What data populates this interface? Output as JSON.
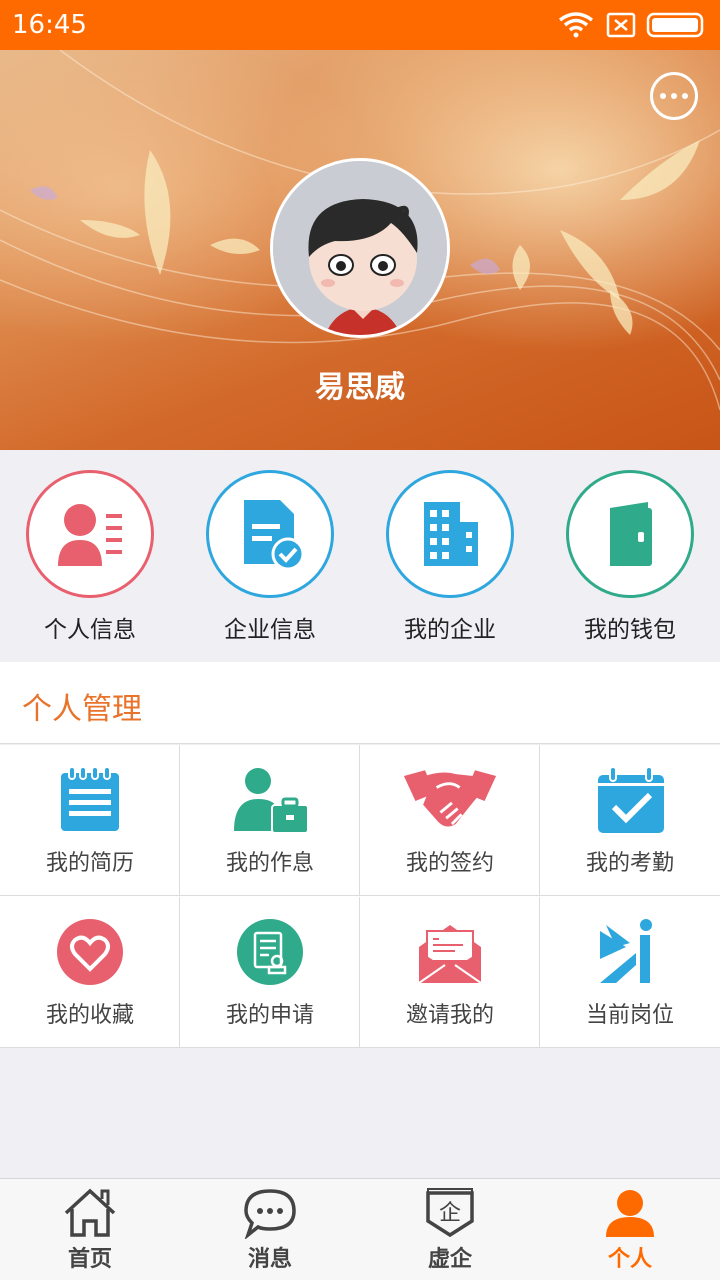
{
  "status_bar": {
    "time": "16:45"
  },
  "header": {
    "user_name": "易思威",
    "more_icon": "more-dots-icon"
  },
  "quick_actions": [
    {
      "label": "个人信息",
      "icon": "profile-card-icon",
      "color": "#e8606e"
    },
    {
      "label": "企业信息",
      "icon": "document-check-icon",
      "color": "#2ea7df"
    },
    {
      "label": "我的企业",
      "icon": "building-icon",
      "color": "#2ea7df"
    },
    {
      "label": "我的钱包",
      "icon": "wallet-icon",
      "color": "#2faa8a"
    }
  ],
  "section": {
    "title": "个人管理",
    "accent": "#e8732a",
    "items": [
      {
        "label": "我的简历",
        "icon": "resume-notepad-icon"
      },
      {
        "label": "我的作息",
        "icon": "person-briefcase-icon"
      },
      {
        "label": "我的签约",
        "icon": "handshake-icon"
      },
      {
        "label": "我的考勤",
        "icon": "calendar-check-icon"
      },
      {
        "label": "我的收藏",
        "icon": "heart-icon"
      },
      {
        "label": "我的申请",
        "icon": "application-form-icon"
      },
      {
        "label": "邀请我的",
        "icon": "envelope-invite-icon"
      },
      {
        "label": "当前岗位",
        "icon": "position-icon"
      }
    ]
  },
  "bottom_nav": {
    "active_color": "#ff6a00",
    "items": [
      {
        "label": "首页",
        "icon": "home-icon"
      },
      {
        "label": "消息",
        "icon": "chat-bubble-icon"
      },
      {
        "label": "虚企",
        "icon": "virtual-company-icon",
        "glyph": "企"
      },
      {
        "label": "个人",
        "icon": "person-icon",
        "active": true
      }
    ]
  }
}
